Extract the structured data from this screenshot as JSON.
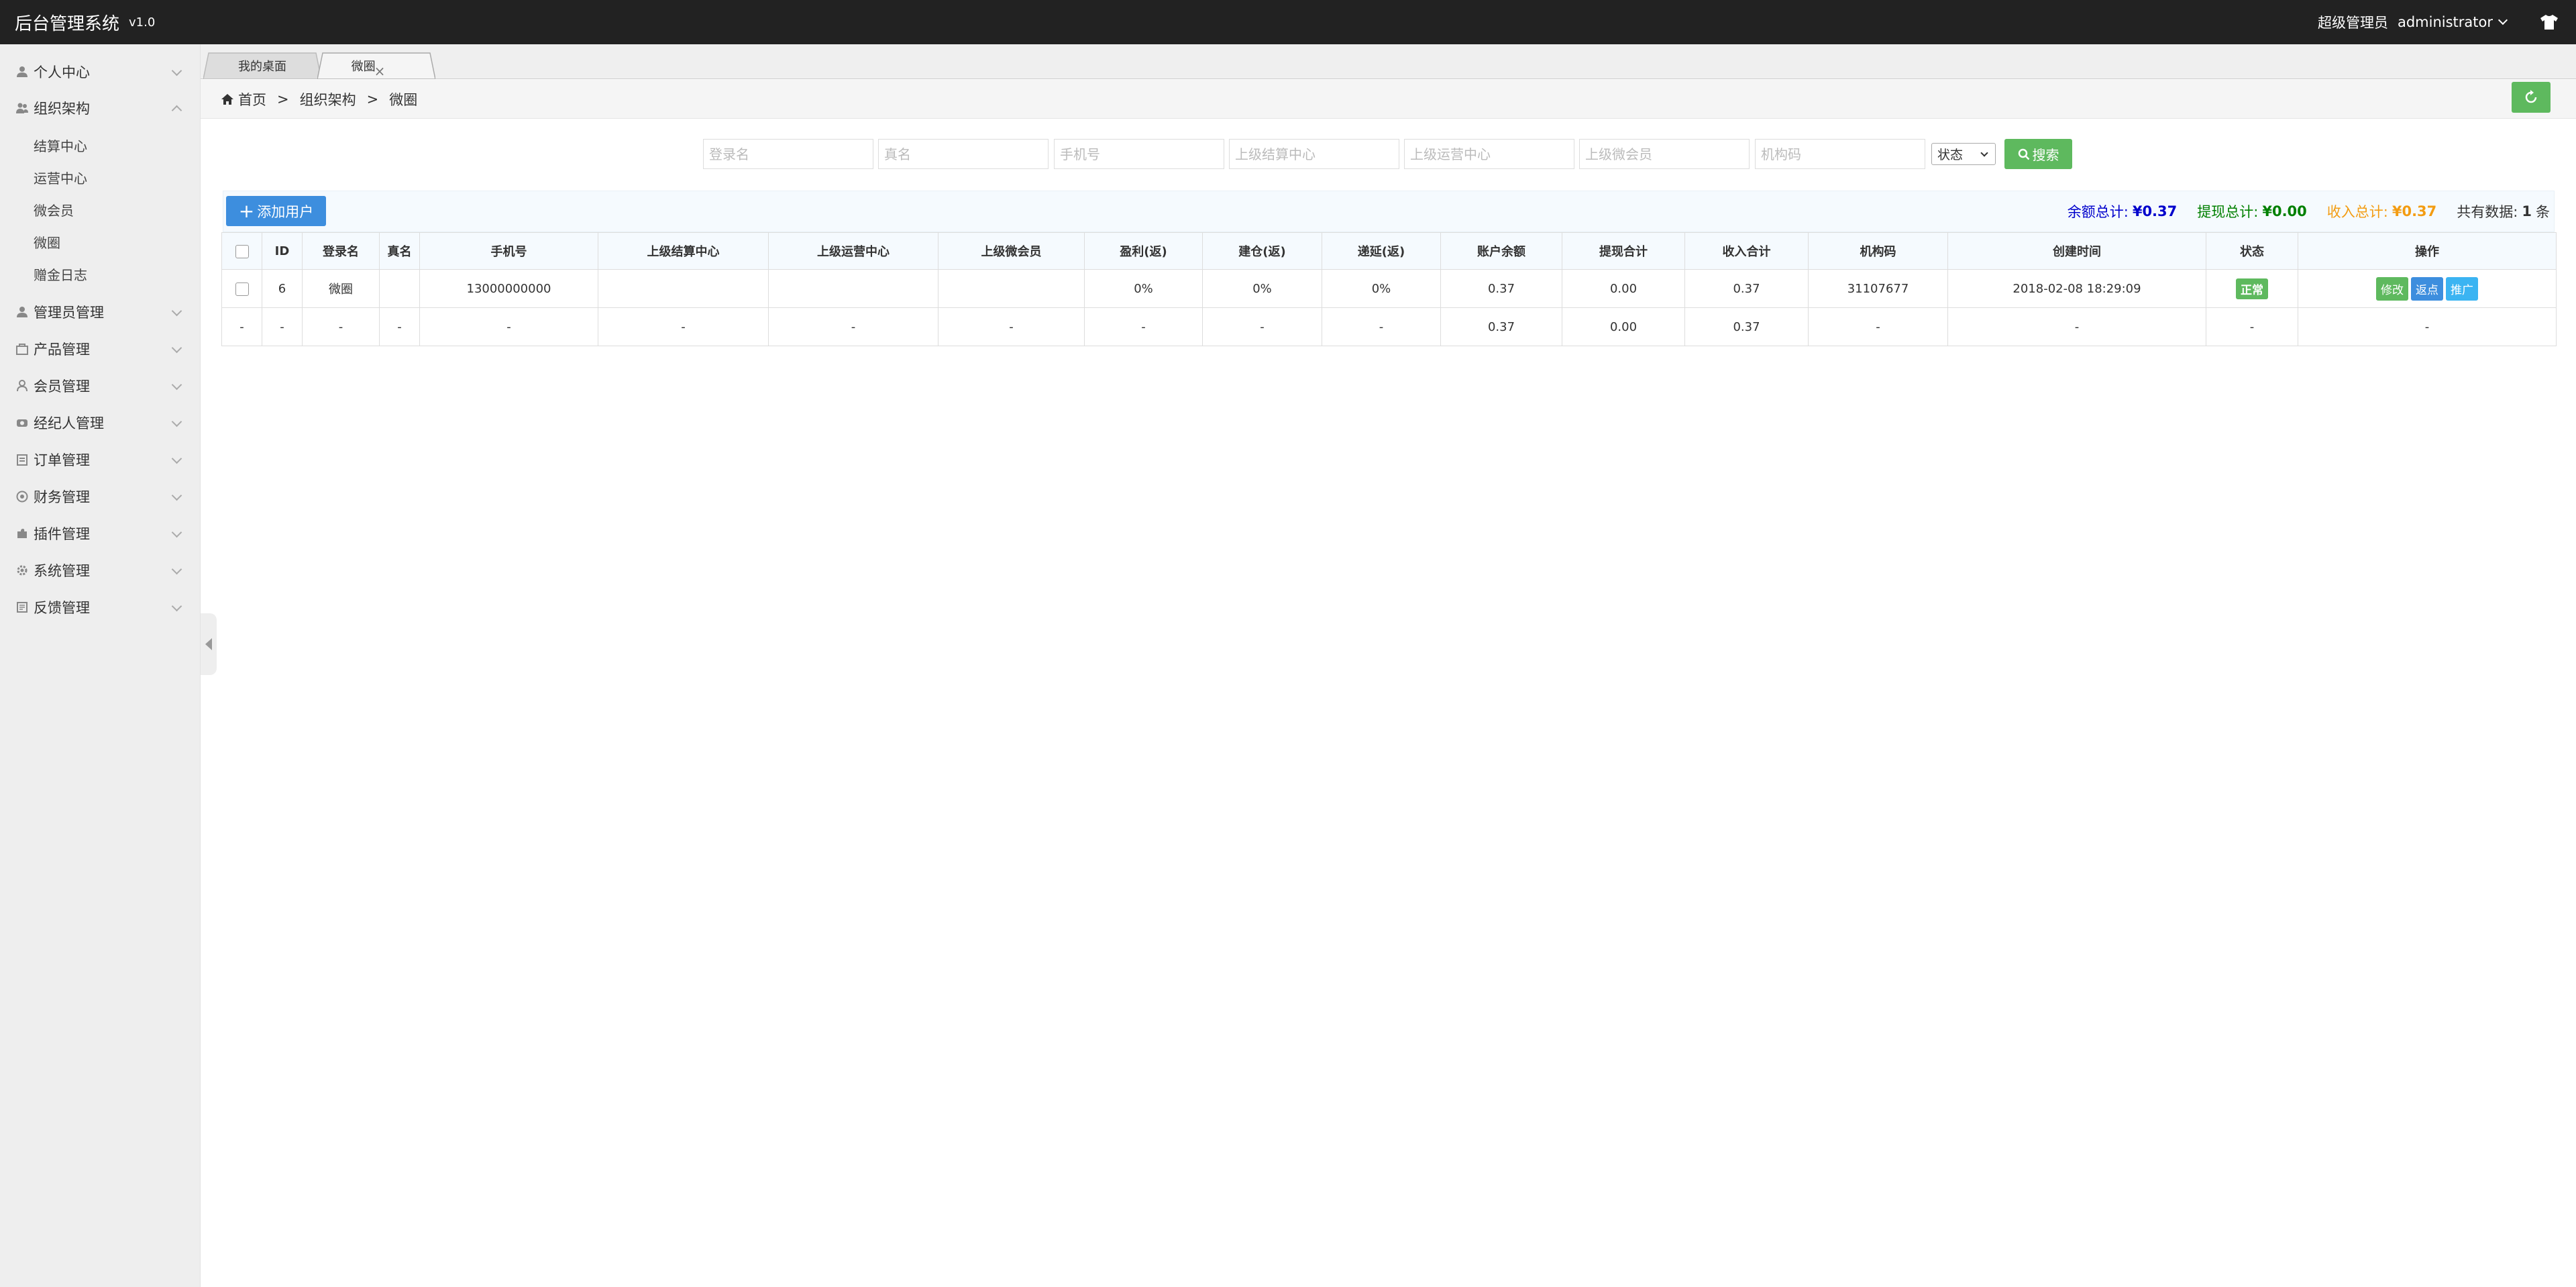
{
  "header": {
    "title": "后台管理系统",
    "version": "v1.0",
    "role": "超级管理员",
    "username": "administrator"
  },
  "sidebar": {
    "items": [
      {
        "label": "个人中心",
        "icon": "user-icon",
        "expanded": false
      },
      {
        "label": "组织架构",
        "icon": "org-icon",
        "expanded": true,
        "children": [
          "结算中心",
          "运营中心",
          "微会员",
          "微圈",
          "赠金日志"
        ]
      },
      {
        "label": "管理员管理",
        "icon": "user-icon",
        "expanded": false
      },
      {
        "label": "产品管理",
        "icon": "box-icon",
        "expanded": false
      },
      {
        "label": "会员管理",
        "icon": "member-icon",
        "expanded": false
      },
      {
        "label": "经纪人管理",
        "icon": "broker-icon",
        "expanded": false
      },
      {
        "label": "订单管理",
        "icon": "cart-icon",
        "expanded": false
      },
      {
        "label": "财务管理",
        "icon": "money-icon",
        "expanded": false
      },
      {
        "label": "插件管理",
        "icon": "puzzle-icon",
        "expanded": false
      },
      {
        "label": "系统管理",
        "icon": "gear-icon",
        "expanded": false
      },
      {
        "label": "反馈管理",
        "icon": "feedback-icon",
        "expanded": false
      }
    ]
  },
  "tabs": [
    {
      "label": "我的桌面",
      "active": false
    },
    {
      "label": "微圈",
      "active": true,
      "close": "×"
    }
  ],
  "breadcrumb": {
    "home": "首页",
    "sep": ">",
    "level1": "组织架构",
    "level2": "微圈"
  },
  "search": {
    "login_name_placeholder": "登录名",
    "real_name_placeholder": "真名",
    "phone_placeholder": "手机号",
    "settle_center_placeholder": "上级结算中心",
    "ops_center_placeholder": "上级运营中心",
    "micro_member_placeholder": "上级微会员",
    "org_code_placeholder": "机构码",
    "status_label": "状态",
    "button": "搜索"
  },
  "toolbar": {
    "add_user": "添加用户",
    "balance_label": "余额总计:",
    "balance_value": "¥0.37",
    "withdraw_label": "提现总计:",
    "withdraw_value": "¥0.00",
    "income_label": "收入总计:",
    "income_value": "¥0.37",
    "count_label": "共有数据:",
    "count_value": "1",
    "count_unit": "条"
  },
  "table": {
    "columns": [
      "ID",
      "登录名",
      "真名",
      "手机号",
      "上级结算中心",
      "上级运营中心",
      "上级微会员",
      "盈利(返)",
      "建仓(返)",
      "递延(返)",
      "账户余额",
      "提现合计",
      "收入合计",
      "机构码",
      "创建时间",
      "状态",
      "操作"
    ],
    "rows": [
      {
        "id": "6",
        "login": "微圈",
        "real": "",
        "phone": "13000000000",
        "settle": "",
        "ops": "",
        "micro": "",
        "profit": "0%",
        "build": "0%",
        "defer": "0%",
        "balance": "0.37",
        "withdraw": "0.00",
        "income": "0.37",
        "code": "31107677",
        "created": "2018-02-08 18:29:09",
        "status": "正常",
        "ops_btns": [
          "修改",
          "返点",
          "推广"
        ]
      }
    ],
    "summary": {
      "dash": "-",
      "balance": "0.37",
      "withdraw": "0.00",
      "income": "0.37"
    }
  },
  "colors": {
    "header_bg": "#222222",
    "sidebar_bg": "#eeeeee",
    "green": "#5eb95e",
    "blue": "#3d8ede",
    "cyan": "#3bb4f2",
    "balance_text": "#0000cc",
    "withdraw_text": "#008000",
    "income_text": "#f39c12"
  }
}
